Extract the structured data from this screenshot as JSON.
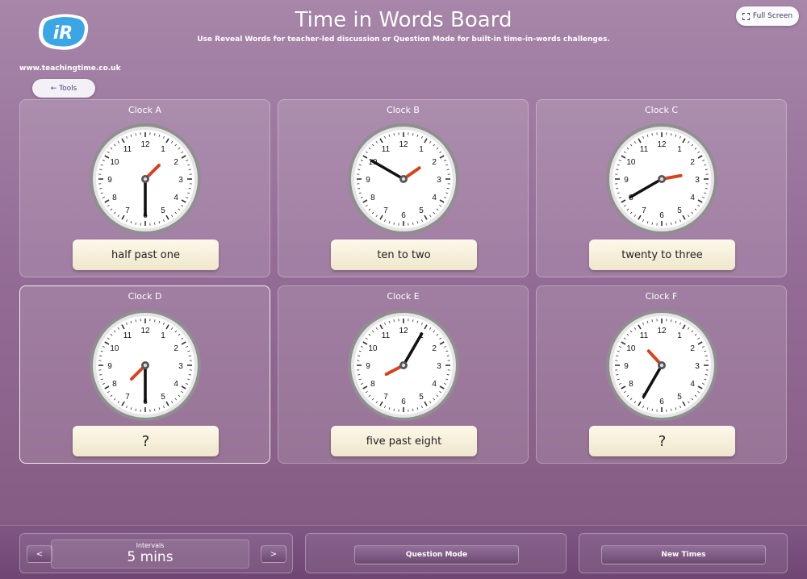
{
  "logo": {
    "text": "iR",
    "color": "#3aa6e6"
  },
  "site_url": "www.teachingtime.co.uk",
  "tools_button": "← Tools",
  "header": {
    "title": "Time in Words Board",
    "subtitle": "Use Reveal Words for teacher-led discussion or Question Mode for built-in time-in-words challenges."
  },
  "fullscreen_button": "Full Screen",
  "clock_numbers": [
    "12",
    "1",
    "2",
    "3",
    "4",
    "5",
    "6",
    "7",
    "8",
    "9",
    "10",
    "11"
  ],
  "colors": {
    "hour_hand": "#d8431e",
    "minute_hand": "#111111",
    "answer_bg": "#f7f0dc"
  },
  "clocks": [
    {
      "label": "Clock A",
      "hour": 1,
      "minute": 30,
      "answer": "half past one",
      "selected": false
    },
    {
      "label": "Clock B",
      "hour": 1,
      "minute": 50,
      "answer": "ten to two",
      "selected": false
    },
    {
      "label": "Clock C",
      "hour": 2,
      "minute": 40,
      "answer": "twenty to three",
      "selected": false
    },
    {
      "label": "Clock D",
      "hour": 7,
      "minute": 30,
      "answer": "?",
      "selected": true
    },
    {
      "label": "Clock E",
      "hour": 8,
      "minute": 5,
      "answer": "five past eight",
      "selected": false
    },
    {
      "label": "Clock F",
      "hour": 10,
      "minute": 35,
      "answer": "?",
      "selected": false
    }
  ],
  "footer": {
    "prev_label": "<",
    "next_label": ">",
    "intervals_label": "Intervals",
    "intervals_value": "5 mins",
    "question_mode_label": "Question Mode",
    "new_times_label": "New Times"
  }
}
